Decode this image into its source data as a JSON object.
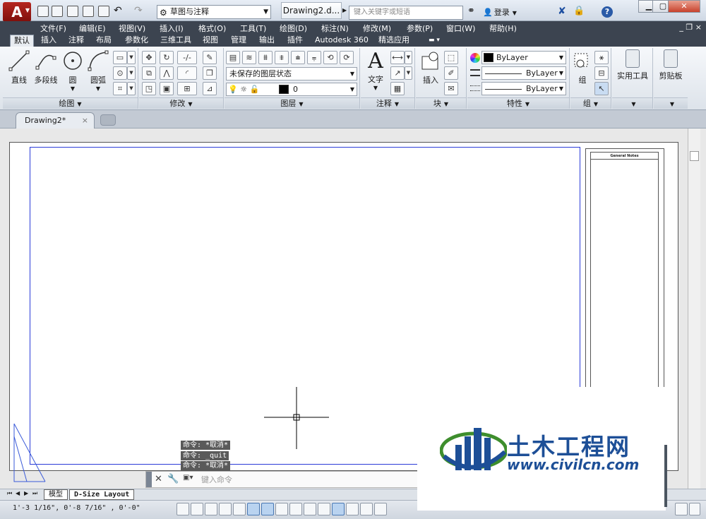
{
  "titlebar": {
    "app_letter": "A",
    "workspace": "草图与注释",
    "doc_title": "Drawing2.d...",
    "search_placeholder": "键入关键字或短语",
    "login": "登录",
    "help": "?"
  },
  "menu": {
    "items": [
      "文件(F)",
      "编辑(E)",
      "视图(V)",
      "插入(I)",
      "格式(O)",
      "工具(T)",
      "绘图(D)",
      "标注(N)",
      "修改(M)",
      "参数(P)",
      "窗口(W)",
      "帮助(H)"
    ],
    "controls": "_ ❐ ×"
  },
  "ribbon_tabs": [
    "默认",
    "插入",
    "注释",
    "布局",
    "参数化",
    "三维工具",
    "视图",
    "管理",
    "输出",
    "插件",
    "Autodesk 360",
    "精选应用"
  ],
  "ribbon": {
    "draw": {
      "title": "绘图",
      "line": "直线",
      "polyline": "多段线",
      "circle": "圆",
      "arc": "圆弧"
    },
    "modify": {
      "title": "修改"
    },
    "layers": {
      "title": "图层",
      "layer_state": "未保存的图层状态",
      "current_layer": "0"
    },
    "annotation": {
      "title": "注释",
      "text": "文字"
    },
    "block": {
      "title": "块",
      "insert": "插入"
    },
    "properties": {
      "title": "特性",
      "color": "ByLayer",
      "linetype": "ByLayer",
      "lineweight": "ByLayer"
    },
    "group": {
      "title": "组",
      "group": "组"
    },
    "utilities": {
      "label": "实用工具"
    },
    "clipboard": {
      "label": "剪贴板"
    }
  },
  "doc_tabs": {
    "active": "Drawing2*"
  },
  "sheet": {
    "notes_title": "General Notes"
  },
  "command": {
    "history": [
      "命令: *取消*",
      "命令: _quit",
      "命令: *取消*"
    ],
    "placeholder": "键入命令"
  },
  "layout_tabs": [
    "模型",
    "D-Size Layout"
  ],
  "status": {
    "coords": "1'-3 1/16\",  0'-8 7/16\" , 0'-0\""
  },
  "watermark": {
    "name": "土木工程网",
    "url": "www.civilcn.com"
  }
}
